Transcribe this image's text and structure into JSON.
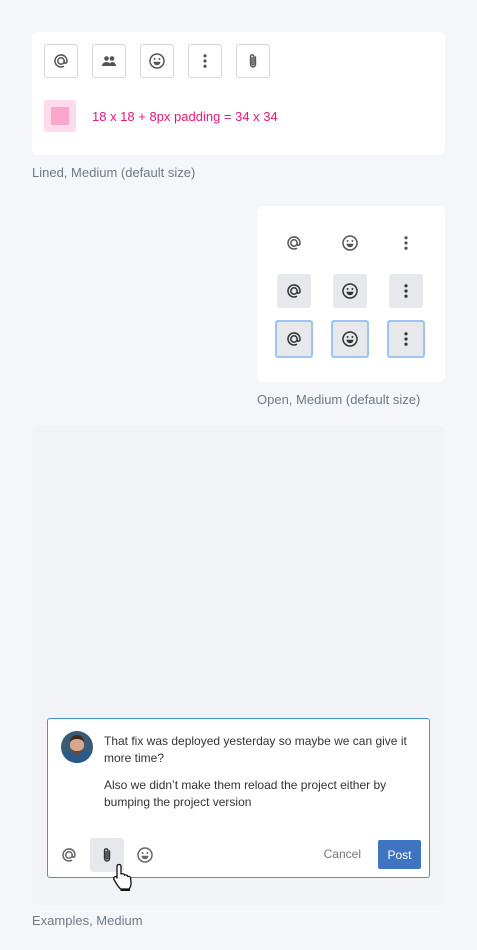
{
  "lined_section": {
    "caption": "Lined, Medium (default size)",
    "measure_label": "18 x 18 + 8px padding = 34 x 34",
    "buttons": [
      {
        "icon": "at-icon"
      },
      {
        "icon": "people-icon"
      },
      {
        "icon": "emoji-icon"
      },
      {
        "icon": "more-vertical-icon"
      },
      {
        "icon": "paperclip-icon"
      }
    ],
    "measure_colors": {
      "outer": "#ffdcec",
      "inner": "#fba6cd",
      "text": "#e5177a"
    }
  },
  "open_section": {
    "caption": "Open, Medium (default size)",
    "rows": [
      {
        "state": "default",
        "icons": [
          "at-icon",
          "emoji-icon",
          "more-vertical-icon"
        ]
      },
      {
        "state": "hover",
        "icons": [
          "at-icon",
          "emoji-icon",
          "more-vertical-icon"
        ]
      },
      {
        "state": "focus",
        "icons": [
          "at-icon",
          "emoji-icon",
          "more-vertical-icon"
        ]
      }
    ],
    "focus_ring_color": "#9cc5f5"
  },
  "examples_section": {
    "caption": "Examples, Medium",
    "composer": {
      "message_1": "That fix was deployed yesterday so maybe we can give it more time?",
      "message_2": "Also we didn’t make them reload the project either by bumping the project version",
      "cancel_label": "Cancel",
      "post_label": "Post",
      "tools": [
        "at-icon",
        "paperclip-icon",
        "emoji-icon"
      ],
      "border_color": "#4a90d9",
      "post_color": "#3e74c0"
    }
  }
}
